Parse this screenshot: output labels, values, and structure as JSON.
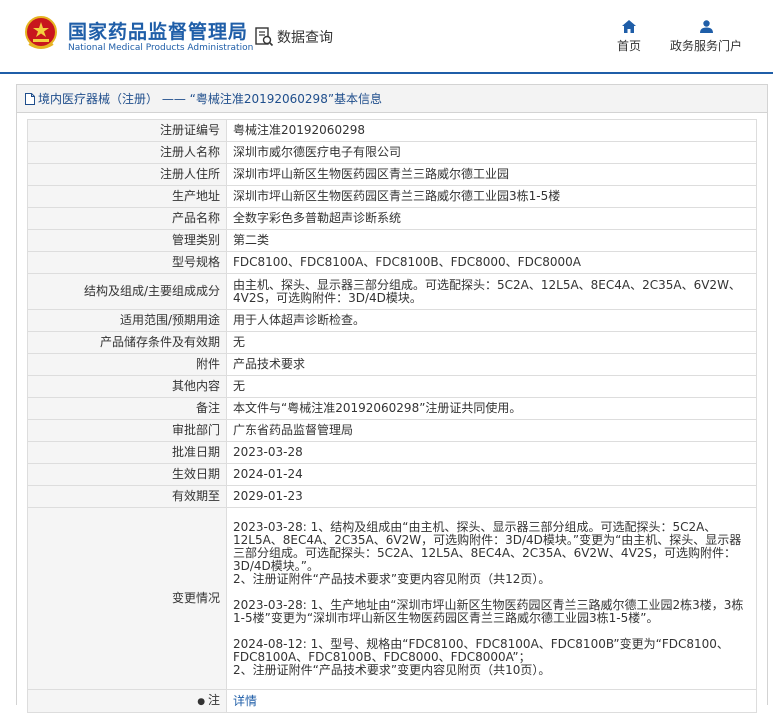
{
  "header": {
    "brand_cn": "国家药品监督管理局",
    "brand_en": "National Medical Products Administration",
    "data_query": "数据查询",
    "nav": [
      {
        "label": "首页",
        "icon": "home-icon"
      },
      {
        "label": "政务服务门户",
        "icon": "user-icon"
      }
    ],
    "accent_color": "#1f5ea8"
  },
  "breadcrumb": {
    "text": "境内医疗器械（注册） —— “粤械注准20192060298”基本信息"
  },
  "table": {
    "rows": [
      {
        "label": "注册证编号",
        "value": "粤械注准20192060298"
      },
      {
        "label": "注册人名称",
        "value": "深圳市威尔德医疗电子有限公司"
      },
      {
        "label": "注册人住所",
        "value": "深圳市坪山新区生物医药园区青兰三路威尔德工业园"
      },
      {
        "label": "生产地址",
        "value": "深圳市坪山新区生物医药园区青兰三路威尔德工业园3栋1-5楼"
      },
      {
        "label": "产品名称",
        "value": "全数字彩色多普勒超声诊断系统"
      },
      {
        "label": "管理类别",
        "value": "第二类"
      },
      {
        "label": "型号规格",
        "value": "FDC8100、FDC8100A、FDC8100B、FDC8000、FDC8000A"
      },
      {
        "label": "结构及组成/主要组成成分",
        "value": "由主机、探头、显示器三部分组成。可选配探头：5C2A、12L5A、8EC4A、2C35A、6V2W、4V2S，可选购附件：3D/4D模块。"
      },
      {
        "label": "适用范围/预期用途",
        "value": "用于人体超声诊断检查。"
      },
      {
        "label": "产品储存条件及有效期",
        "value": "无"
      },
      {
        "label": "附件",
        "value": "产品技术要求"
      },
      {
        "label": "其他内容",
        "value": "无"
      },
      {
        "label": "备注",
        "value": "本文件与“粤械注准20192060298”注册证共同使用。"
      },
      {
        "label": "审批部门",
        "value": "广东省药品监督管理局"
      },
      {
        "label": "批准日期",
        "value": "2023-03-28"
      },
      {
        "label": "生效日期",
        "value": "2024-01-24"
      },
      {
        "label": "有效期至",
        "value": "2029-01-23"
      }
    ],
    "changes_label": "变更情况",
    "changes": [
      [
        "2023-03-28: 1、结构及组成由“由主机、探头、显示器三部分组成。可选配探头：5C2A、12L5A、8EC4A、2C35A、6V2W，可选购附件：3D/4D模块。”变更为“由主机、探头、显示器三部分组成。可选配探头：5C2A、12L5A、8EC4A、2C35A、6V2W、4V2S，可选购附件：3D/4D模块。”。",
        "2、注册证附件“产品技术要求”变更内容见附页（共12页）。"
      ],
      [
        "2023-03-28: 1、生产地址由“深圳市坪山新区生物医药园区青兰三路威尔德工业园2栋3楼，3栋1-5楼”变更为“深圳市坪山新区生物医药园区青兰三路威尔德工业园3栋1-5楼”。"
      ],
      [
        "2024-08-12: 1、型号、规格由“FDC8100、FDC8100A、FDC8100B”变更为“FDC8100、FDC8100A、FDC8100B、FDC8000、FDC8000A”；",
        "2、注册证附件“产品技术要求”变更内容见附页（共10页）。"
      ]
    ],
    "note_label": "注",
    "note_link": "详情"
  }
}
